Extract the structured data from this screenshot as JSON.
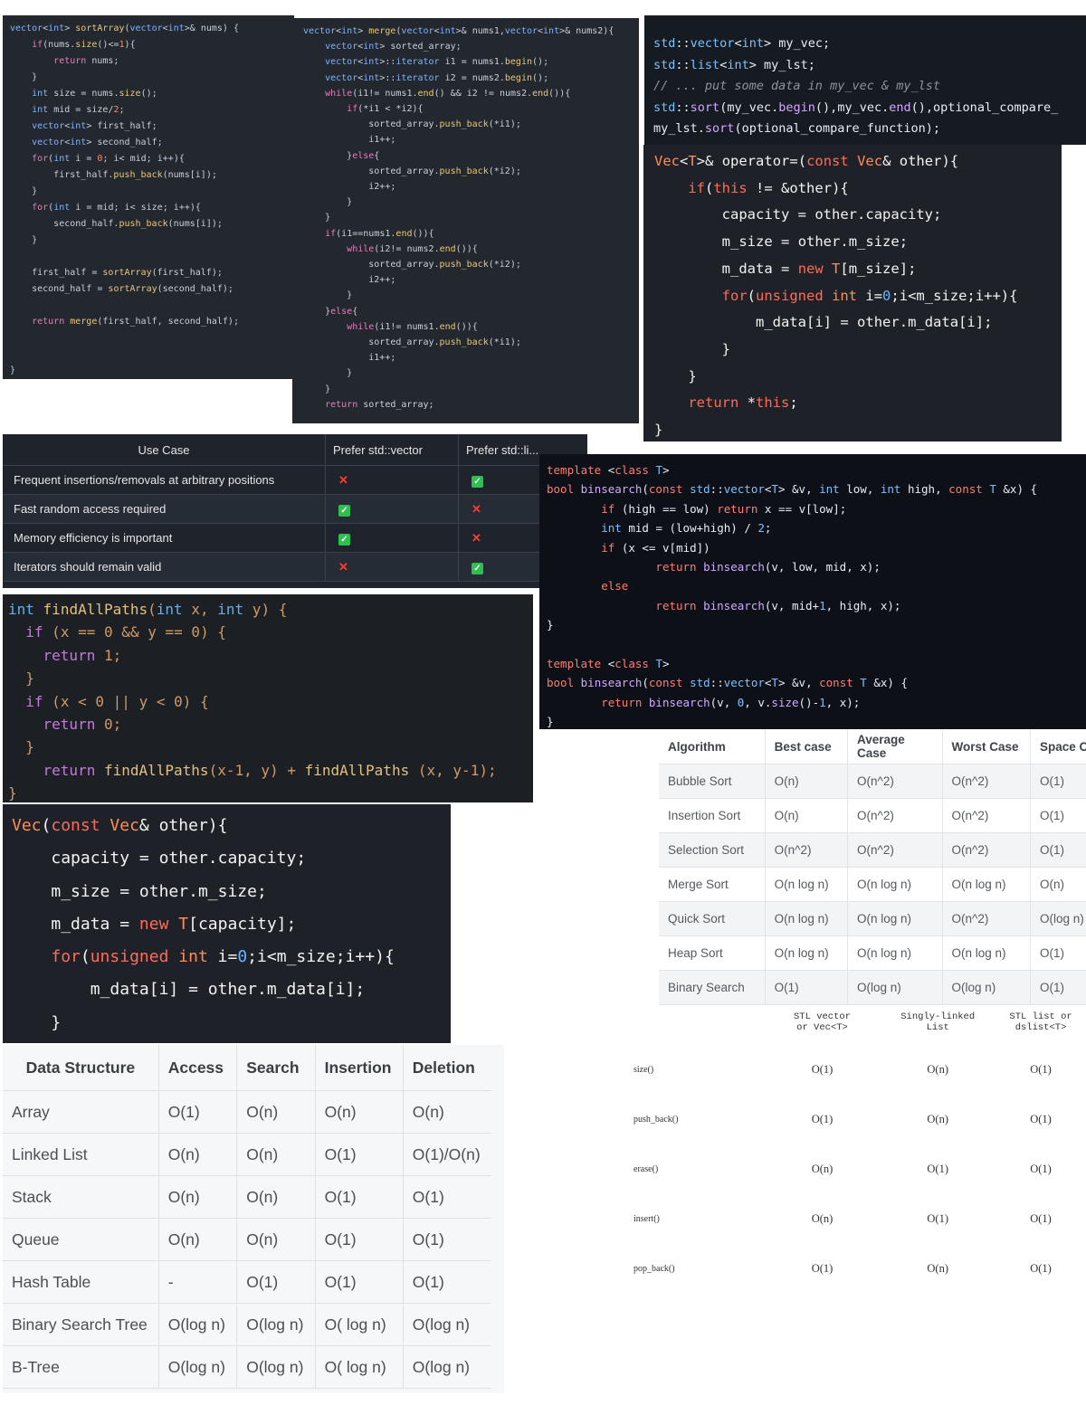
{
  "code_merge_sort": [
    "vector<int> sortArray(vector<int>& nums) {",
    "    if(nums.size()<=1){",
    "        return nums;",
    "    }",
    "    int size = nums.size();",
    "    int mid = size/2;",
    "    vector<int> first_half;",
    "    vector<int> second_half;",
    "    for(int i = 0; i< mid; i++){",
    "        first_half.push_back(nums[i]);",
    "    }",
    "    for(int i = mid; i< size; i++){",
    "        second_half.push_back(nums[i]);",
    "    }",
    "",
    "    first_half = sortArray(first_half);",
    "    second_half = sortArray(second_half);",
    "",
    "    return merge(first_half, second_half);",
    "",
    "",
    "}"
  ],
  "code_merge": [
    "vector<int> merge(vector<int>& nums1,vector<int>& nums2){",
    "    vector<int> sorted_array;",
    "    vector<int>::iterator i1 = nums1.begin();",
    "    vector<int>::iterator i2 = nums2.begin();",
    "    while(i1!= nums1.end() && i2 != nums2.end()){",
    "        if(*i1 < *i2){",
    "            sorted_array.push_back(*i1);",
    "            i1++;",
    "        }else{",
    "            sorted_array.push_back(*i2);",
    "            i2++;",
    "        }",
    "    }",
    "    if(i1==nums1.end()){",
    "        while(i2!= nums2.end()){",
    "            sorted_array.push_back(*i2);",
    "            i2++;",
    "        }",
    "    }else{",
    "        while(i1!= nums1.end()){",
    "            sorted_array.push_back(*i1);",
    "            i1++;",
    "        }",
    "    }",
    "    return sorted_array;"
  ],
  "code_std_sort": [
    "std::vector<int> my_vec;",
    "std::list<int> my_lst;",
    "// ... put some data in my_vec & my_lst",
    "std::sort(my_vec.begin(),my_vec.end(),optional_compare_",
    "my_lst.sort(optional_compare_function);"
  ],
  "code_assign_operator": [
    "Vec<T>& operator=(const Vec& other){",
    "    if(this != &other){",
    "        capacity = other.capacity;",
    "        m_size = other.m_size;",
    "        m_data = new T[m_size];",
    "        for(unsigned int i=0;i<m_size;i++){",
    "            m_data[i] = other.m_data[i];",
    "        }",
    "    }",
    "    return *this;",
    "}"
  ],
  "vector_vs_list": {
    "headers": [
      "Use Case",
      "Prefer std::vector",
      "Prefer std::li..."
    ],
    "rows": [
      {
        "use_case": "Frequent insertions/removals at arbitrary positions",
        "vector": "cross",
        "list": "check"
      },
      {
        "use_case": "Fast random access required",
        "vector": "check",
        "list": "cross"
      },
      {
        "use_case": "Memory efficiency is important",
        "vector": "check",
        "list": "cross"
      },
      {
        "use_case": "Iterators should remain valid",
        "vector": "cross",
        "list": "check"
      }
    ]
  },
  "code_binsearch": [
    "template <class T>",
    "bool binsearch(const std::vector<T> &v, int low, int high, const T &x) {",
    "        if (high == low) return x == v[low];",
    "        int mid = (low+high) / 2;",
    "        if (x <= v[mid])",
    "                return binsearch(v, low, mid, x);",
    "        else",
    "                return binsearch(v, mid+1, high, x);",
    "}",
    "",
    "template <class T>",
    "bool binsearch(const std::vector<T> &v, const T &x) {",
    "        return binsearch(v, 0, v.size()-1, x);",
    "}"
  ],
  "code_find_all_paths": [
    "int findAllPaths(int x, int y) {",
    "  if (x == 0 && y == 0) {",
    "    return 1;",
    "  }",
    "  if (x < 0 || y < 0) {",
    "    return 0;",
    "  }",
    "    return findAllPaths(x-1, y) + findAllPaths (x, y-1);",
    "}"
  ],
  "algorithms_table": {
    "headers": [
      "Algorithm",
      "Best case",
      "Average Case",
      "Worst Case",
      "Space Co"
    ],
    "rows": [
      [
        "Bubble Sort",
        "O(n)",
        "O(n^2)",
        "O(n^2)",
        "O(1)"
      ],
      [
        "Insertion Sort",
        "O(n)",
        "O(n^2)",
        "O(n^2)",
        "O(1)"
      ],
      [
        "Selection Sort",
        "O(n^2)",
        "O(n^2)",
        "O(n^2)",
        "O(1)"
      ],
      [
        "Merge Sort",
        "O(n log n)",
        "O(n log n)",
        "O(n log n)",
        "O(n)"
      ],
      [
        "Quick Sort",
        "O(n log n)",
        "O(n log n)",
        "O(n^2)",
        "O(log n)"
      ],
      [
        "Heap Sort",
        "O(n log n)",
        "O(n log n)",
        "O(n log n)",
        "O(1)"
      ],
      [
        "Binary Search",
        "O(1)",
        "O(log n)",
        "O(log n)",
        "O(1)"
      ]
    ]
  },
  "code_copy_constructor": [
    "Vec(const Vec& other){",
    "    capacity = other.capacity;",
    "    m_size = other.m_size;",
    "    m_data = new T[capacity];",
    "    for(unsigned int i=0;i<m_size;i++){",
    "        m_data[i] = other.m_data[i];",
    "    }"
  ],
  "data_structures_table": {
    "headers": [
      "Data Structure",
      "Access",
      "Search",
      "Insertion",
      "Deletion"
    ],
    "rows": [
      [
        "Array",
        "O(1)",
        "O(n)",
        "O(n)",
        "O(n)"
      ],
      [
        "Linked List",
        "O(n)",
        "O(n)",
        "O(1)",
        "O(1)/O(n)"
      ],
      [
        "Stack",
        "O(n)",
        "O(n)",
        "O(1)",
        "O(1)"
      ],
      [
        "Queue",
        "O(n)",
        "O(n)",
        "O(1)",
        "O(1)"
      ],
      [
        "Hash Table",
        "-",
        "O(1)",
        "O(1)",
        "O(1)"
      ],
      [
        "Binary Search Tree",
        "O(log n)",
        "O(log n)",
        "O( log n)",
        "O(log n)"
      ],
      [
        "B-Tree",
        "O(log n)",
        "O(log n)",
        "O( log n)",
        "O(log n)"
      ]
    ]
  },
  "container_ops_table": {
    "headers": [
      "",
      "STL vector\nor Vec<T>",
      "Singly-linked\nList",
      "STL list or\ndslist<T>"
    ],
    "rows": [
      [
        "size()",
        "O(1)",
        "O(n)",
        "O(1)"
      ],
      [
        "push_back()",
        "O(1)",
        "O(n)",
        "O(1)"
      ],
      [
        "erase()",
        "O(n)",
        "O(1)",
        "O(1)"
      ],
      [
        "insert()",
        "O(n)",
        "O(1)",
        "O(1)"
      ],
      [
        "pop_back()",
        "O(1)",
        "O(n)",
        "O(1)"
      ]
    ]
  }
}
